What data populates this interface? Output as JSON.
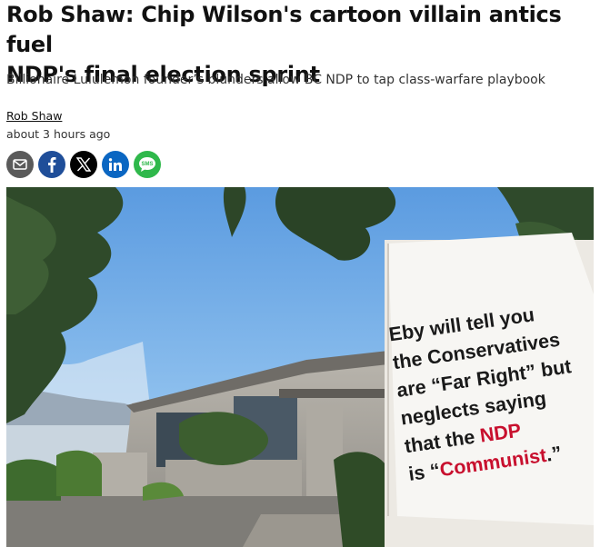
{
  "article": {
    "headline_line1": "Rob Shaw: Chip Wilson's cartoon villain antics fuel",
    "headline_line2": "NDP's final election sprint",
    "subhead": "Billionaire Lululemon founder’s blunders allow BC NDP to tap class-warfare playbook",
    "author": "Rob Shaw",
    "timestamp": "about 3 hours ago"
  },
  "share": {
    "buttons": [
      {
        "icon": "email-icon",
        "color": "#5a5a5a"
      },
      {
        "icon": "facebook-icon",
        "color": "#1f4e99"
      },
      {
        "icon": "x-icon",
        "color": "#000000"
      },
      {
        "icon": "linkedin-icon",
        "color": "#0a66c2"
      },
      {
        "icon": "sms-icon",
        "color": "#2fb84b",
        "label": "SMS"
      }
    ]
  },
  "photo": {
    "sign_lines": [
      "Eby will tell you",
      "the Conservatives",
      "are “Far Right” but",
      "neglects saying",
      "that the",
      "NDP",
      "is “",
      "Communist",
      ".”"
    ]
  },
  "colors": {
    "accent_red": "#c8102e",
    "sky": "#7fb3e6"
  }
}
